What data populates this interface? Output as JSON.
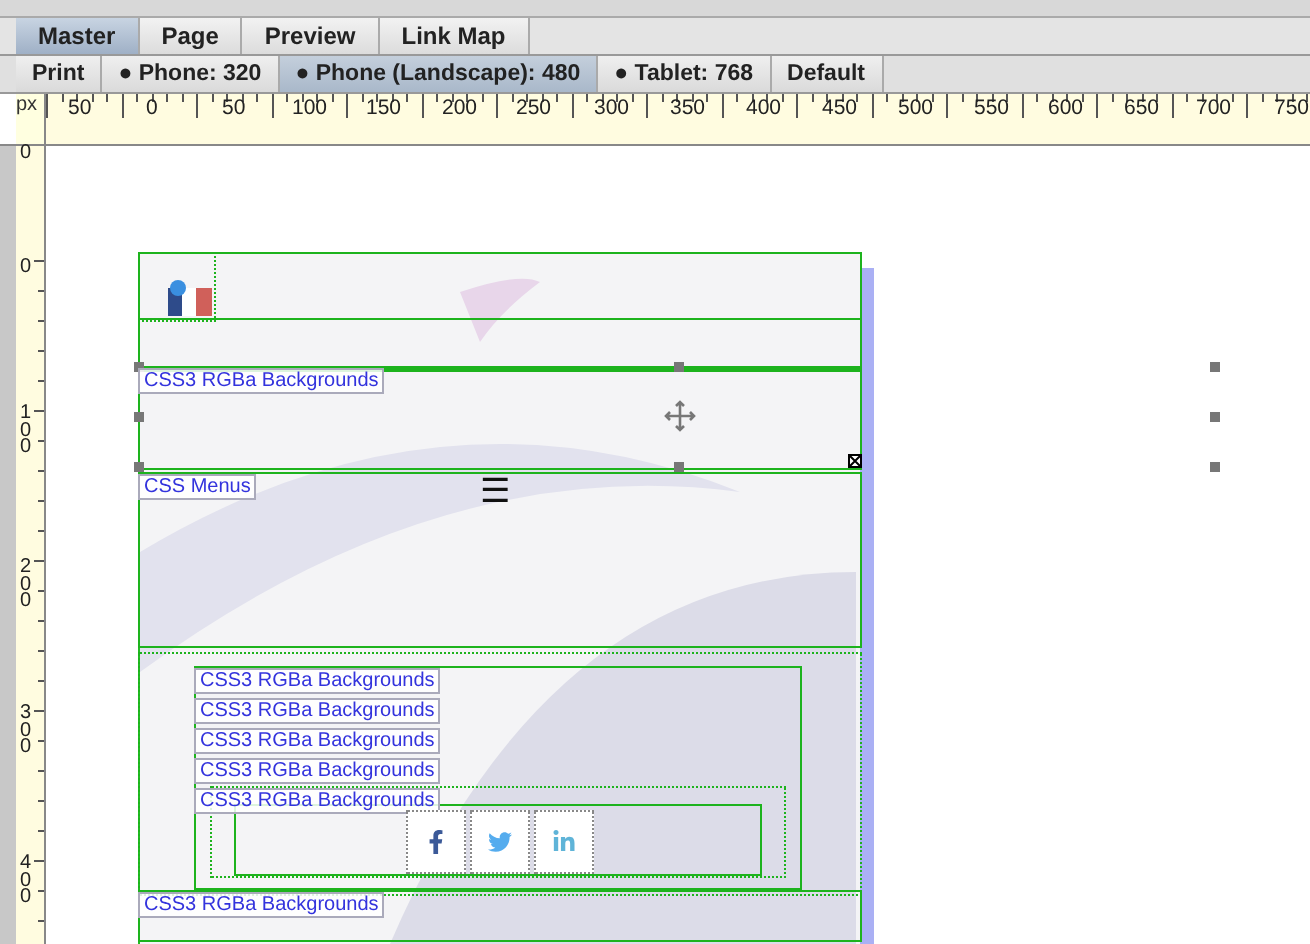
{
  "view_tabs": [
    {
      "label": "Master",
      "selected": true
    },
    {
      "label": "Page",
      "selected": false
    },
    {
      "label": "Preview",
      "selected": false
    },
    {
      "label": "Link Map",
      "selected": false
    }
  ],
  "breakpoints": [
    {
      "label": "Print",
      "selected": false
    },
    {
      "label": "● Phone: 320",
      "selected": false
    },
    {
      "label": "● Phone (Landscape): 480",
      "selected": true
    },
    {
      "label": "● Tablet: 768",
      "selected": false
    },
    {
      "label": "Default",
      "selected": false
    }
  ],
  "ruler": {
    "unit": "px",
    "h_labels": [
      "50",
      "0",
      "50",
      "100",
      "150",
      "200",
      "250",
      "300",
      "350",
      "400",
      "450",
      "500",
      "550",
      "600",
      "650",
      "700",
      "750"
    ],
    "v_labels": [
      "0",
      "0",
      "100",
      "200",
      "300",
      "400"
    ]
  },
  "canvas": {
    "element_labels": [
      "CSS3 RGBa Backgrounds",
      "CSS Menus",
      "CSS3 RGBa Backgrounds",
      "CSS3 RGBa Backgrounds",
      "CSS3 RGBa Backgrounds",
      "CSS3 RGBa Backgrounds",
      "CSS3 RGBa Backgrounds",
      "CSS3 RGBa Backgrounds"
    ],
    "menu_icon": "☰"
  }
}
